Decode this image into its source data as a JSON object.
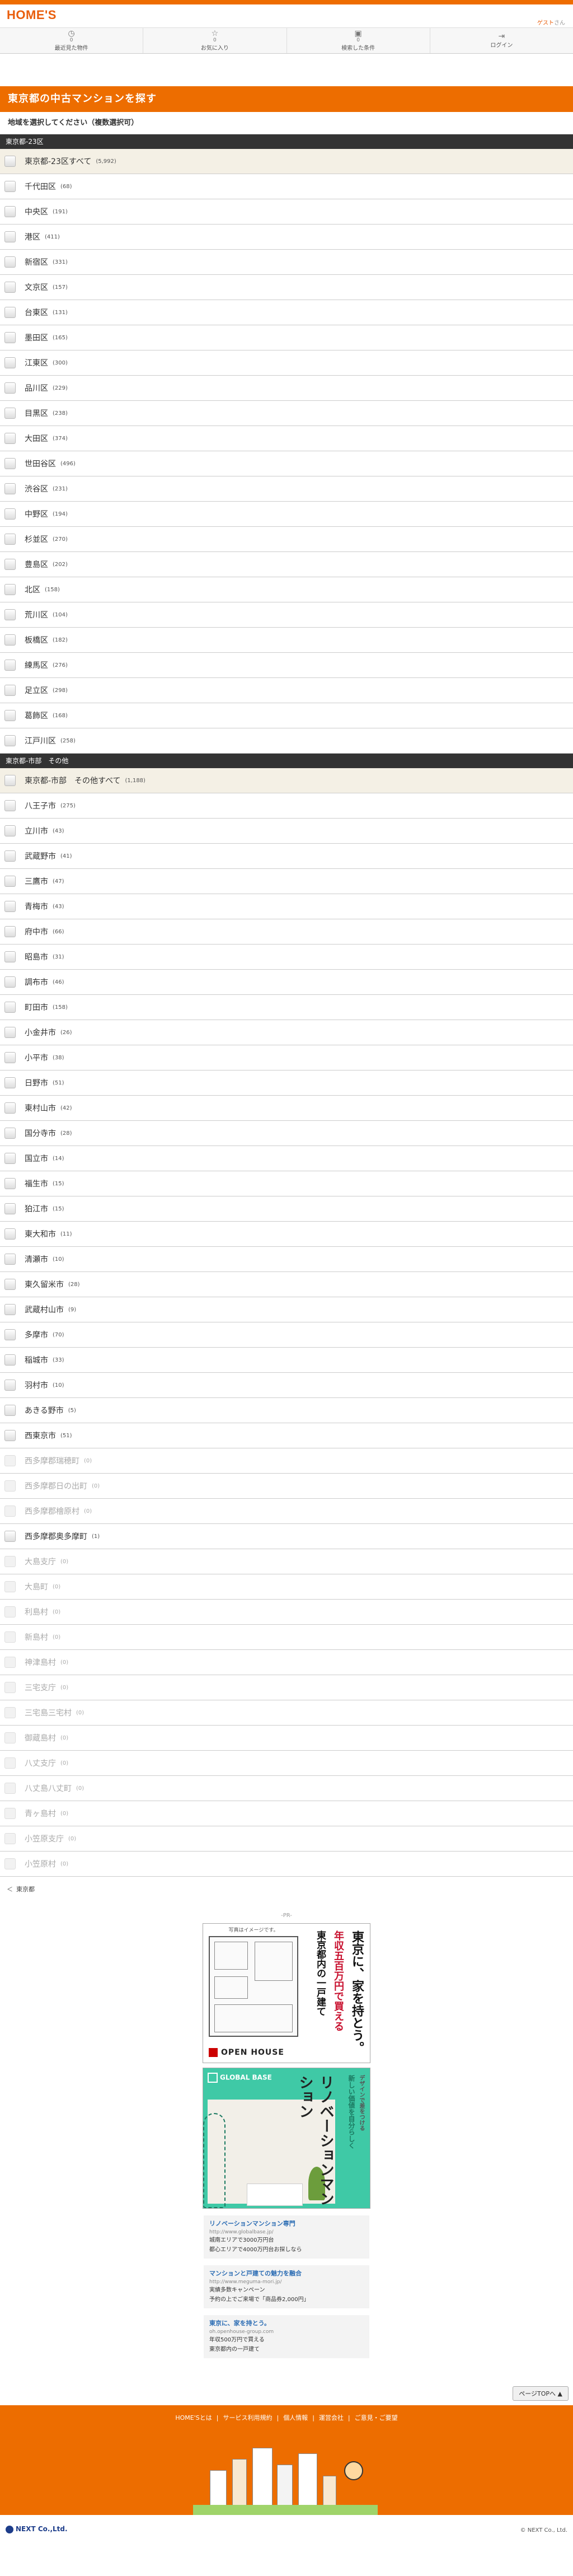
{
  "header": {
    "logo": "HOME'S",
    "greeting_user": "ゲスト",
    "greeting_suffix": "さん"
  },
  "nav": [
    {
      "icon": "clock-icon",
      "glyph": "◷",
      "count": "0",
      "label": "最近見た物件"
    },
    {
      "icon": "star-icon",
      "glyph": "☆",
      "count": "0",
      "label": "お気に入り"
    },
    {
      "icon": "search-history-icon",
      "glyph": "▣",
      "count": "0",
      "label": "検索した条件"
    },
    {
      "icon": "login-icon",
      "glyph": "⇥",
      "count": "",
      "label": "ログイン"
    }
  ],
  "page": {
    "title": "東京都の中古マンションを探す",
    "instruction": "地域を選択してください（複数選択可）"
  },
  "sections": [
    {
      "name": "東京都-23区",
      "all": {
        "name": "東京都-23区すべて",
        "count": "(5,992)"
      },
      "items": [
        {
          "name": "千代田区",
          "count": "(68)",
          "disabled": false
        },
        {
          "name": "中央区",
          "count": "(191)",
          "disabled": false
        },
        {
          "name": "港区",
          "count": "(411)",
          "disabled": false
        },
        {
          "name": "新宿区",
          "count": "(331)",
          "disabled": false
        },
        {
          "name": "文京区",
          "count": "(157)",
          "disabled": false
        },
        {
          "name": "台東区",
          "count": "(131)",
          "disabled": false
        },
        {
          "name": "墨田区",
          "count": "(165)",
          "disabled": false
        },
        {
          "name": "江東区",
          "count": "(300)",
          "disabled": false
        },
        {
          "name": "品川区",
          "count": "(229)",
          "disabled": false
        },
        {
          "name": "目黒区",
          "count": "(238)",
          "disabled": false
        },
        {
          "name": "大田区",
          "count": "(374)",
          "disabled": false
        },
        {
          "name": "世田谷区",
          "count": "(496)",
          "disabled": false
        },
        {
          "name": "渋谷区",
          "count": "(231)",
          "disabled": false
        },
        {
          "name": "中野区",
          "count": "(194)",
          "disabled": false
        },
        {
          "name": "杉並区",
          "count": "(270)",
          "disabled": false
        },
        {
          "name": "豊島区",
          "count": "(202)",
          "disabled": false
        },
        {
          "name": "北区",
          "count": "(158)",
          "disabled": false
        },
        {
          "name": "荒川区",
          "count": "(104)",
          "disabled": false
        },
        {
          "name": "板橋区",
          "count": "(182)",
          "disabled": false
        },
        {
          "name": "練馬区",
          "count": "(276)",
          "disabled": false
        },
        {
          "name": "足立区",
          "count": "(298)",
          "disabled": false
        },
        {
          "name": "葛飾区",
          "count": "(168)",
          "disabled": false
        },
        {
          "name": "江戸川区",
          "count": "(258)",
          "disabled": false
        }
      ]
    },
    {
      "name": "東京都-市部　その他",
      "all": {
        "name": "東京都-市部　その他すべて",
        "count": "(1,188)"
      },
      "items": [
        {
          "name": "八王子市",
          "count": "(275)",
          "disabled": false
        },
        {
          "name": "立川市",
          "count": "(43)",
          "disabled": false
        },
        {
          "name": "武蔵野市",
          "count": "(41)",
          "disabled": false
        },
        {
          "name": "三鷹市",
          "count": "(47)",
          "disabled": false
        },
        {
          "name": "青梅市",
          "count": "(43)",
          "disabled": false
        },
        {
          "name": "府中市",
          "count": "(66)",
          "disabled": false
        },
        {
          "name": "昭島市",
          "count": "(31)",
          "disabled": false
        },
        {
          "name": "調布市",
          "count": "(46)",
          "disabled": false
        },
        {
          "name": "町田市",
          "count": "(158)",
          "disabled": false
        },
        {
          "name": "小金井市",
          "count": "(26)",
          "disabled": false
        },
        {
          "name": "小平市",
          "count": "(38)",
          "disabled": false
        },
        {
          "name": "日野市",
          "count": "(51)",
          "disabled": false
        },
        {
          "name": "東村山市",
          "count": "(42)",
          "disabled": false
        },
        {
          "name": "国分寺市",
          "count": "(28)",
          "disabled": false
        },
        {
          "name": "国立市",
          "count": "(14)",
          "disabled": false
        },
        {
          "name": "福生市",
          "count": "(15)",
          "disabled": false
        },
        {
          "name": "狛江市",
          "count": "(15)",
          "disabled": false
        },
        {
          "name": "東大和市",
          "count": "(11)",
          "disabled": false
        },
        {
          "name": "清瀬市",
          "count": "(10)",
          "disabled": false
        },
        {
          "name": "東久留米市",
          "count": "(28)",
          "disabled": false
        },
        {
          "name": "武蔵村山市",
          "count": "(9)",
          "disabled": false
        },
        {
          "name": "多摩市",
          "count": "(70)",
          "disabled": false
        },
        {
          "name": "稲城市",
          "count": "(33)",
          "disabled": false
        },
        {
          "name": "羽村市",
          "count": "(10)",
          "disabled": false
        },
        {
          "name": "あきる野市",
          "count": "(5)",
          "disabled": false
        },
        {
          "name": "西東京市",
          "count": "(51)",
          "disabled": false
        },
        {
          "name": "西多摩郡瑞穂町",
          "count": "(0)",
          "disabled": true
        },
        {
          "name": "西多摩郡日の出町",
          "count": "(0)",
          "disabled": true
        },
        {
          "name": "西多摩郡檜原村",
          "count": "(0)",
          "disabled": true
        },
        {
          "name": "西多摩郡奥多摩町",
          "count": "(1)",
          "disabled": false
        },
        {
          "name": "大島支庁",
          "count": "(0)",
          "disabled": true
        },
        {
          "name": "大島町",
          "count": "(0)",
          "disabled": true
        },
        {
          "name": "利島村",
          "count": "(0)",
          "disabled": true
        },
        {
          "name": "新島村",
          "count": "(0)",
          "disabled": true
        },
        {
          "name": "神津島村",
          "count": "(0)",
          "disabled": true
        },
        {
          "name": "三宅支庁",
          "count": "(0)",
          "disabled": true
        },
        {
          "name": "三宅島三宅村",
          "count": "(0)",
          "disabled": true
        },
        {
          "name": "御蔵島村",
          "count": "(0)",
          "disabled": true
        },
        {
          "name": "八丈支庁",
          "count": "(0)",
          "disabled": true
        },
        {
          "name": "八丈島八丈町",
          "count": "(0)",
          "disabled": true
        },
        {
          "name": "青ヶ島村",
          "count": "(0)",
          "disabled": true
        },
        {
          "name": "小笠原支庁",
          "count": "(0)",
          "disabled": true
        },
        {
          "name": "小笠原村",
          "count": "(0)",
          "disabled": true
        }
      ]
    }
  ],
  "footnote": {
    "back": "＜",
    "text": "東京都"
  },
  "ads": {
    "label": "-PR-",
    "ad1": {
      "caption": "写真はイメージです。",
      "headline1": "東京に、家を持とう。",
      "headline2": "年収五百万円で買える",
      "headline3": "東京都内の一戸建て",
      "brand": "OPEN HOUSE"
    },
    "ad2": {
      "brand": "GLOBAL BASE",
      "headline": "リノベーションマンション",
      "sub": "新しい価値を自分らしく",
      "sub2": "デザインで差をつける"
    },
    "text_ads": [
      {
        "title": "リノベーションマンション専門",
        "url": "http://www.globalbase.jp/",
        "desc1": "城南エリアで3000万円台",
        "desc2": "都心エリアで4000万円台お探しなら"
      },
      {
        "title": "マンションと戸建ての魅力を融合",
        "url": "http://www.meguma-mori.jp/",
        "desc1": "実績多数キャンペーン",
        "desc2": "予約の上でご来場で「商品券2,000円」"
      },
      {
        "title": "東京に、家を持とう。",
        "url": "oh.openhouse-group.com",
        "desc1": "年収500万円で買える",
        "desc2": "東京都内の一戸建て"
      }
    ]
  },
  "pagetop": "ページTOPへ ▲",
  "footer": {
    "links": [
      "HOME'Sとは",
      "サービス利用規約",
      "個人情報",
      "運営会社",
      "ご意見・ご要望"
    ],
    "separator": "|"
  },
  "bottom": {
    "logo": "NEXT Co.,Ltd.",
    "copyright": "© NEXT Co., Ltd."
  },
  "colors": {
    "brand": "#ed6d00",
    "section": "#333333",
    "all_row": "#f4f0e5"
  }
}
